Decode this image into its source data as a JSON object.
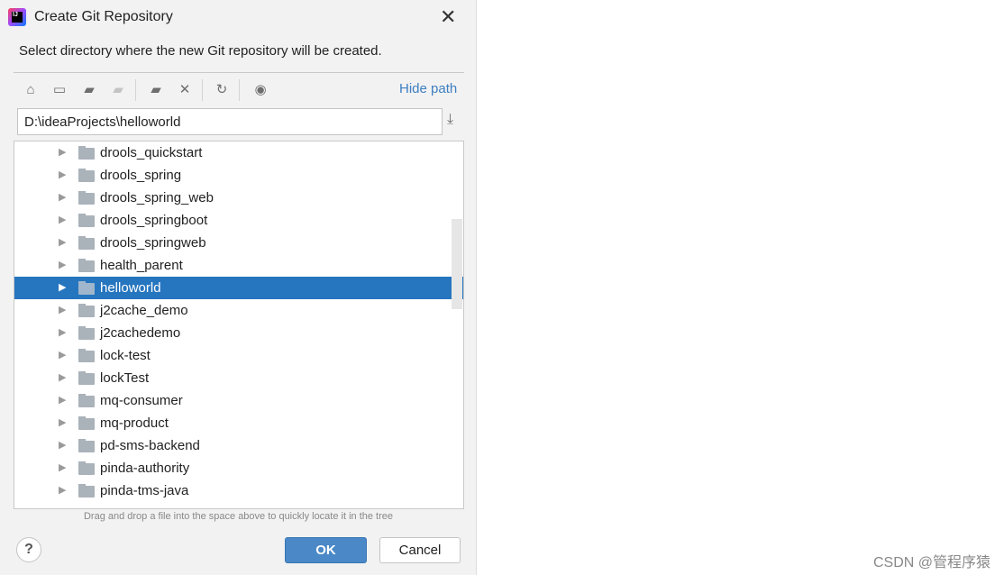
{
  "window": {
    "title": "Create Git Repository",
    "close_icon": "close-icon"
  },
  "description": "Select directory where the new Git repository will be created.",
  "toolbar": {
    "icons": [
      "home-icon",
      "desktop-icon",
      "project-folder-icon",
      "module-folder-icon",
      "new-folder-icon",
      "delete-icon",
      "refresh-icon",
      "show-hidden-icon"
    ],
    "hide_path": "Hide path"
  },
  "path": {
    "value": "D:\\ideaProjects\\helloworld"
  },
  "tree": {
    "selected": "helloworld",
    "items": [
      "drools_quickstart",
      "drools_spring",
      "drools_spring_web",
      "drools_springboot",
      "drools_springweb",
      "health_parent",
      "helloworld",
      "j2cache_demo",
      "j2cachedemo",
      "lock-test",
      "lockTest",
      "mq-consumer",
      "mq-product",
      "pd-sms-backend",
      "pinda-authority",
      "pinda-tms-java"
    ]
  },
  "hint": "Drag and drop a file into the space above to quickly locate it in the tree",
  "buttons": {
    "help": "?",
    "ok": "OK",
    "cancel": "Cancel"
  },
  "watermark": "CSDN @管程序猿",
  "colors": {
    "accent": "#2675bf",
    "link": "#3d7fc1",
    "ok_button": "#4a88c7"
  }
}
